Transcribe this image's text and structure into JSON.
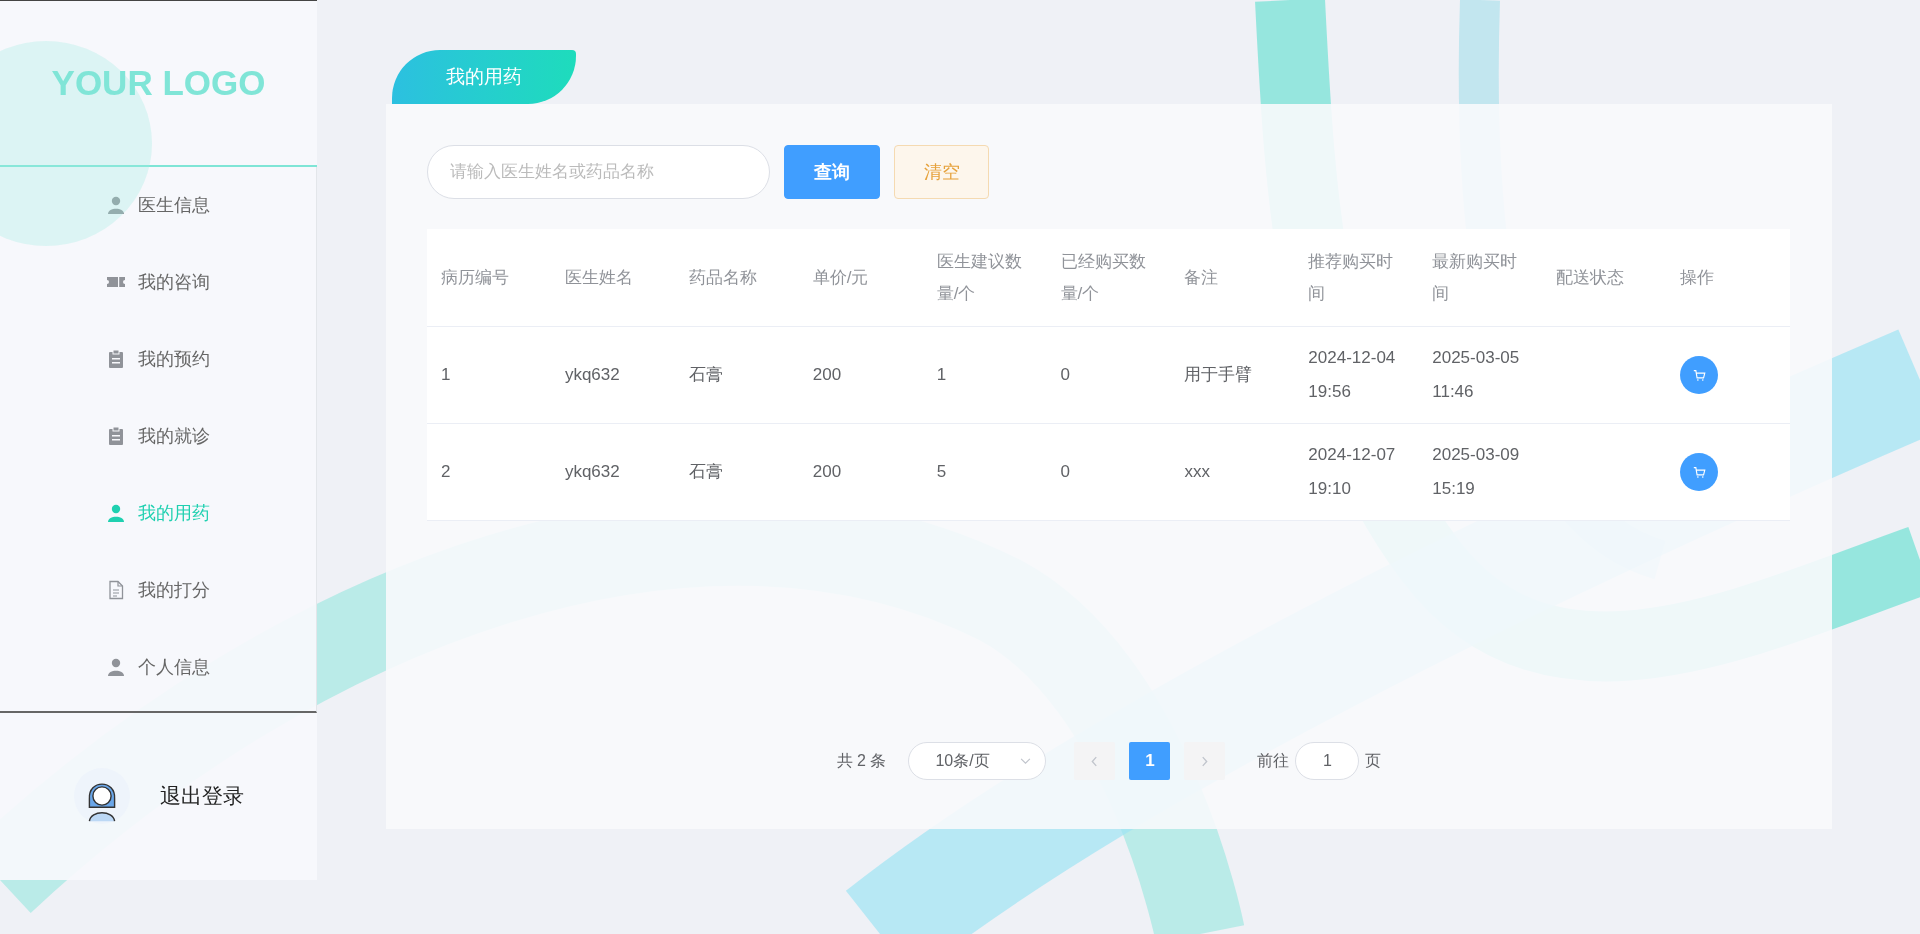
{
  "sidebar": {
    "logo": "YOUR LOGO",
    "items": [
      {
        "label": "医生信息",
        "selected": false
      },
      {
        "label": "我的咨询",
        "selected": false
      },
      {
        "label": "我的预约",
        "selected": false
      },
      {
        "label": "我的就诊",
        "selected": false
      },
      {
        "label": "我的用药",
        "selected": true
      },
      {
        "label": "我的打分",
        "selected": false
      },
      {
        "label": "个人信息",
        "selected": false
      }
    ],
    "logout": "退出登录"
  },
  "page_tab": "我的用药",
  "search": {
    "placeholder": "请输入医生姓名或药品名称",
    "query_button": "查询",
    "clear_button": "清空"
  },
  "table": {
    "columns": [
      "病历编号",
      "医生姓名",
      "药品名称",
      "单价/元",
      "医生建议数量/个",
      "已经购买数量/个",
      "备注",
      "推荐购买时间",
      "最新购买时间",
      "配送状态",
      "操作"
    ],
    "rows": [
      {
        "cells": [
          "1",
          "ykq632",
          "石膏",
          "200",
          "1",
          "0",
          "用于手臂",
          "2024-12-04 19:56",
          "2025-03-05 11:46"
        ]
      },
      {
        "cells": [
          "2",
          "ykq632",
          "石膏",
          "200",
          "5",
          "0",
          "xxx",
          "2024-12-07 19:10",
          "2025-03-09 15:19"
        ]
      }
    ]
  },
  "pagination": {
    "total": "共 2 条",
    "page_size": "10条/页",
    "pages": [
      {
        "label": "1",
        "selected": true
      }
    ],
    "goto_label": "前往",
    "goto_value": "1",
    "goto_suffix": "页"
  }
}
